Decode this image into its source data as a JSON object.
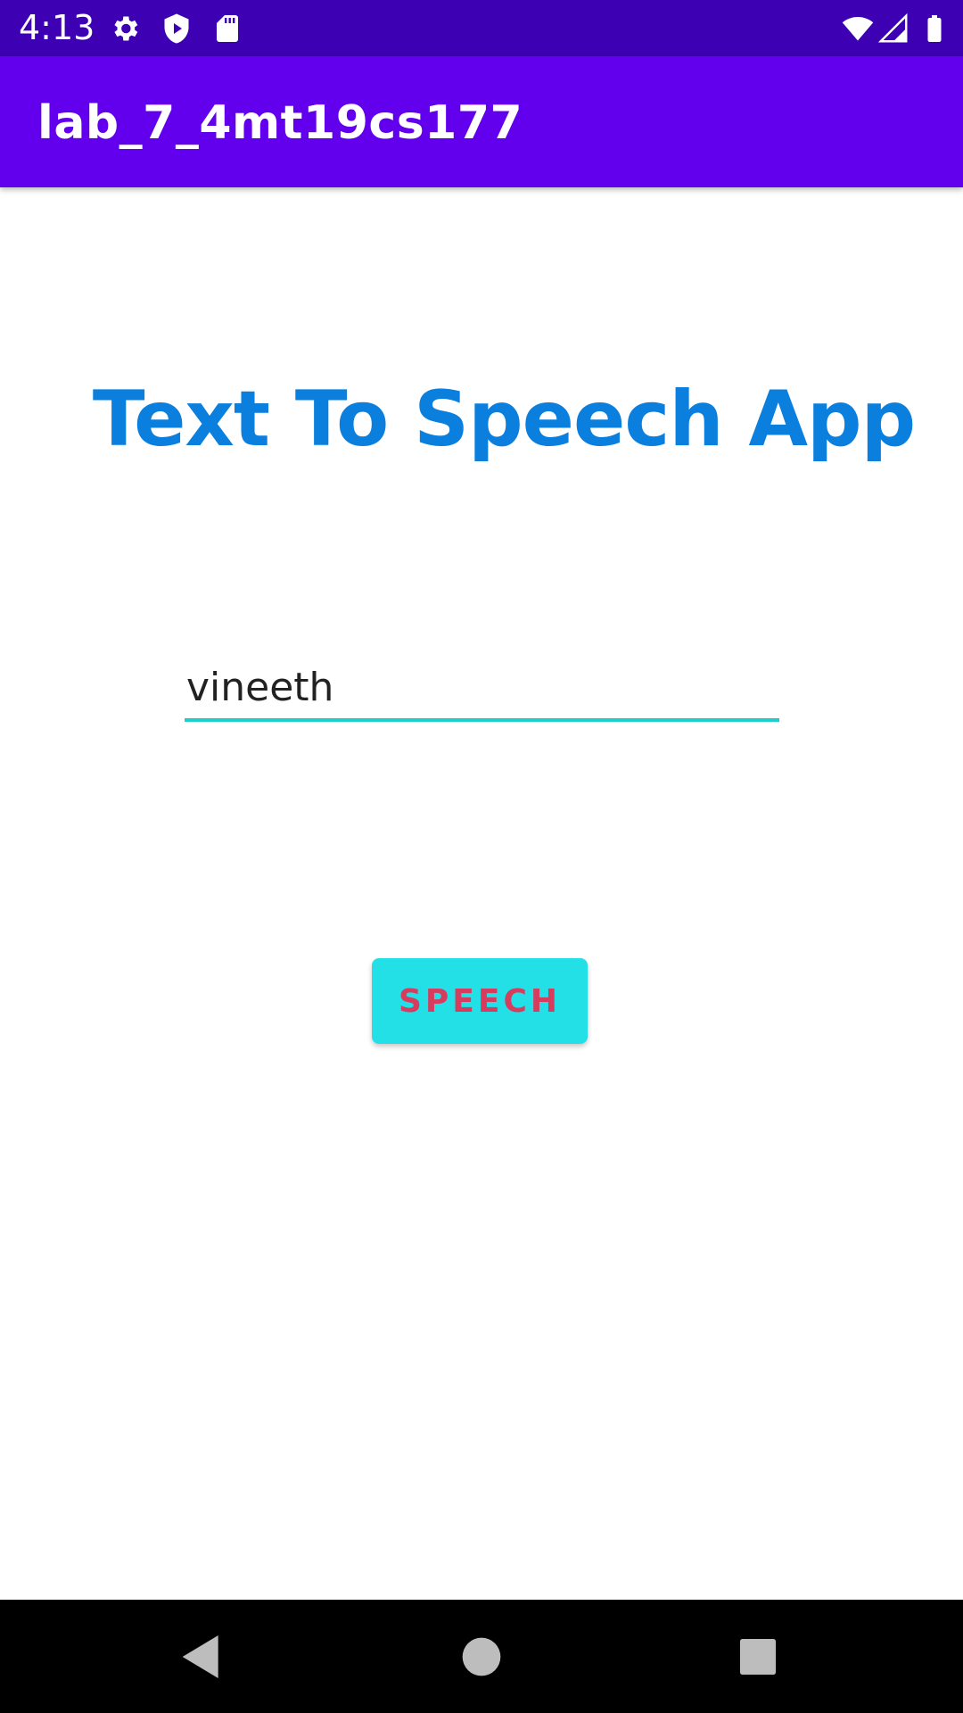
{
  "status_bar": {
    "time": "4:13",
    "left_icons": [
      "gear-icon",
      "shield-play-icon",
      "sd-card-icon"
    ],
    "right_icons": [
      "wifi-icon",
      "cell-signal-icon",
      "battery-icon"
    ],
    "background_color": "#3d00b3"
  },
  "app_bar": {
    "title": "lab_7_4mt19cs177",
    "background_color": "#6200ee"
  },
  "main": {
    "heading": "Text To Speech App",
    "heading_color": "#0a7fde",
    "text_input": {
      "value": "vineeth",
      "underline_color": "#1ccfc9"
    },
    "speech_button": {
      "label": "SPEECH",
      "background_color": "#22e0e6",
      "text_color": "#d73b5e"
    }
  },
  "nav_bar": {
    "buttons": [
      "back-icon",
      "home-icon",
      "recents-icon"
    ]
  }
}
